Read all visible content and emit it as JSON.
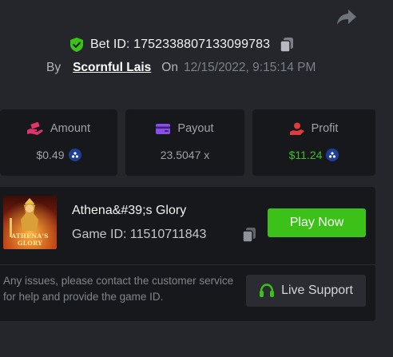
{
  "bet": {
    "id_label": "Bet ID: 1752338807133099783",
    "by_label": "By",
    "user": "Scornful Lais",
    "on_label": "On",
    "date": "12/15/2022, 9:15:14 PM"
  },
  "stats": [
    {
      "label": "Amount",
      "value": "$0.49",
      "icon": "money-hand-icon",
      "accent": "#e2336b"
    },
    {
      "label": "Payout",
      "value": "23.5047 x",
      "icon": "wallet-icon",
      "accent": "#8b4cf0"
    },
    {
      "label": "Profit",
      "value": "$11.24",
      "icon": "profit-icon",
      "accent": "#e23a3a"
    }
  ],
  "game": {
    "name": "Athena&#39;s Glory",
    "id_label": "Game ID: 11510711843",
    "thumb_text_1": "ATHENA'S",
    "thumb_text_2": "GLORY",
    "play_label": "Play Now"
  },
  "support": {
    "text": "Any issues, please contact the customer service for help and provide the game ID.",
    "button_label": "Live Support"
  },
  "colors": {
    "background": "#24262b",
    "card": "#17181c",
    "accent_green": "#3bc117",
    "profit_green": "#3bc117",
    "shield_green": "#3bc117",
    "coin_blue": "#1f3f94"
  }
}
